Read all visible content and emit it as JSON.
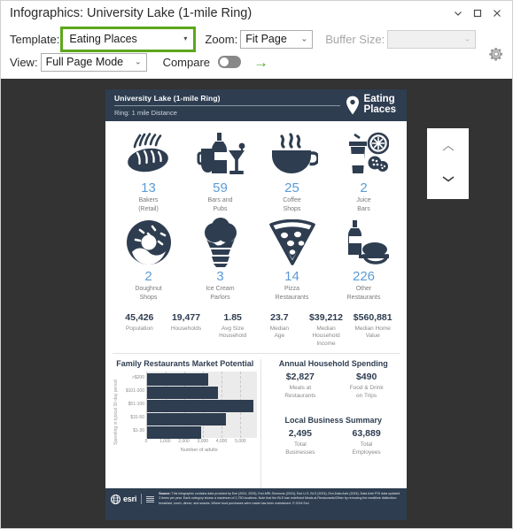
{
  "window": {
    "title": "Infographics: University Lake (1-mile Ring)",
    "minimize_icon": "chevron-down-icon",
    "maximize_icon": "square-icon",
    "close_icon": "close-icon"
  },
  "toolbar": {
    "template_label": "Template:",
    "template_value": "Eating Places",
    "zoom_label": "Zoom:",
    "zoom_value": "Fit Page",
    "buffer_label": "Buffer Size:",
    "buffer_value": "",
    "view_label": "View:",
    "view_value": "Full Page Mode",
    "compare_label": "Compare",
    "compare_on": false,
    "go_arrow": "→",
    "settings_icon": "gear-icon",
    "accent_green": "#5ba81b"
  },
  "pager": {
    "up_icon": "chevron-up-icon",
    "down_icon": "chevron-down-icon"
  },
  "infographic": {
    "header": {
      "title": "University Lake (1-mile Ring)",
      "subtitle": "Ring: 1 mile Distance",
      "brand_line1": "Eating",
      "brand_line2": "Places",
      "pin_icon": "map-pin-icon",
      "bg_color": "#2e3d50"
    },
    "categories": [
      {
        "value": "13",
        "label": "Bakers\n(Retail)",
        "icon": "bread-icon"
      },
      {
        "value": "59",
        "label": "Bars and\nPubs",
        "icon": "drinks-icon"
      },
      {
        "value": "25",
        "label": "Coffee\nShops",
        "icon": "coffee-cup-icon"
      },
      {
        "value": "2",
        "label": "Juice\nBars",
        "icon": "juice-icon"
      },
      {
        "value": "2",
        "label": "Doughnut\nShops",
        "icon": "doughnut-icon"
      },
      {
        "value": "3",
        "label": "Ice Cream\nParlors",
        "icon": "ice-cream-icon"
      },
      {
        "value": "14",
        "label": "Pizza\nRestaurants",
        "icon": "pizza-slice-icon"
      },
      {
        "value": "226",
        "label": "Other\nRestaurants",
        "icon": "wine-and-food-icon"
      }
    ],
    "demographics": [
      {
        "value": "45,426",
        "label": "Population"
      },
      {
        "value": "19,477",
        "label": "Households"
      },
      {
        "value": "1.85",
        "label": "Avg Size\nHousehold"
      },
      {
        "value": "23.7",
        "label": "Median\nAge"
      },
      {
        "value": "$39,212",
        "label": "Median Household\nIncome"
      },
      {
        "value": "$560,881",
        "label": "Median Home\nValue"
      }
    ],
    "market_panel_title": "Family Restaurants Market Potential",
    "spending_panel_title": "Annual Household Spending",
    "spending": [
      {
        "value": "$2,827",
        "label": "Meals at\nRestaurants"
      },
      {
        "value": "$490",
        "label": "Food & Drink\non Trips"
      }
    ],
    "business_panel_title": "Local Business Summary",
    "business": [
      {
        "value": "2,495",
        "label": "Total\nBusinesses"
      },
      {
        "value": "63,889",
        "label": "Total\nEmployees"
      }
    ],
    "footer": {
      "esri_word": "esri",
      "source": "Source: This infographic contains data provided by Esri (2024, 2029), Esri-MRI-Simmons (2024), Esri-U.S. BLS (2024), Esri-Data Axle (2024). Data Axle POI data updated 3 times per year. Each category shows a maximum of 1,750 locations. Note that the BLS has redefined Meals at Restaurants/Other by removing the mealtime distinction: breakfast, lunch, dinner, and snacks. Where food purchases were made has been maintained. © 2024 Esri",
      "source_bold1": "Source:",
      "source_bold2": "Data Axle"
    }
  },
  "chart_data": {
    "type": "bar",
    "orientation": "horizontal",
    "title": "Family Restaurants Market Potential",
    "categories": [
      ">$200",
      "$101-200",
      "$51-100",
      "$31-50",
      "$1-30"
    ],
    "values": [
      3250,
      3800,
      5700,
      4200,
      2900
    ],
    "xlabel": "Number of adults",
    "ylabel": "Spending in typical 30 day period",
    "xlim": [
      0,
      5900
    ],
    "xticks": [
      0,
      1000,
      2000,
      3000,
      4000,
      5000
    ],
    "xtick_labels": [
      "0",
      "1,000",
      "2,000",
      "3,000",
      "4,000",
      "5,000"
    ],
    "bar_color": "#2e3d50",
    "plot_bg": "#ebebeb",
    "grid": true,
    "legend": "none"
  }
}
